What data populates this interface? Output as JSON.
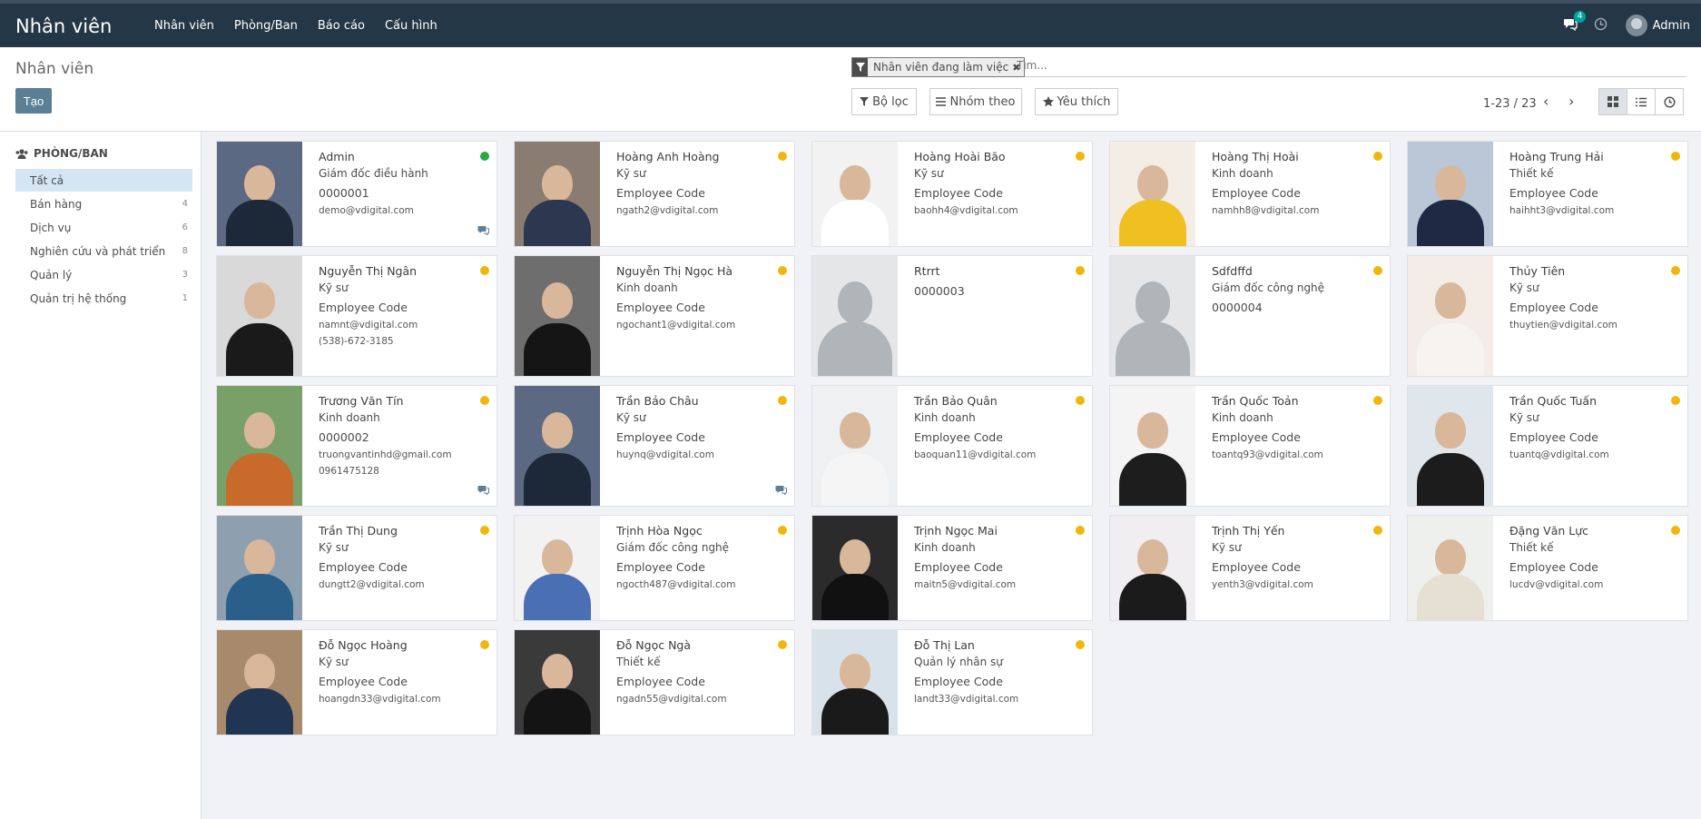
{
  "app": {
    "title": "Nhân viên"
  },
  "menu": [
    "Nhân viên",
    "Phòng/Ban",
    "Báo cáo",
    "Cấu hình"
  ],
  "systray": {
    "messages_count": "4",
    "user": "Admin"
  },
  "control": {
    "breadcrumb": "Nhân viên",
    "create_label": "Tạo",
    "facet": "Nhân viên đang làm việc",
    "search_placeholder": "Tìm...",
    "filter_label": "Bộ lọc",
    "group_label": "Nhóm theo",
    "fav_label": "Yêu thích",
    "pager": "1-23 / 23"
  },
  "sidebar": {
    "title": "PHÒNG/BAN",
    "items": [
      {
        "label": "Tất cả",
        "count": ""
      },
      {
        "label": "Bán hàng",
        "count": "4"
      },
      {
        "label": "Dịch vụ",
        "count": "6"
      },
      {
        "label": "Nghiên cứu và phát triển",
        "count": "8"
      },
      {
        "label": "Quản lý",
        "count": "3"
      },
      {
        "label": "Quản trị hệ thống",
        "count": "1"
      }
    ]
  },
  "employees": [
    {
      "name": "Admin",
      "job": "Giám đốc điều hành",
      "code": "0000001",
      "email": "demo@vdigital.com",
      "phone": "",
      "status": "green",
      "chat": true,
      "bg": "#5b6a82",
      "suit": "#1d2838"
    },
    {
      "name": "Hoàng Anh Hoàng",
      "job": "Kỹ sư",
      "code": "Employee Code",
      "email": "ngath2@vdigital.com",
      "phone": "",
      "status": "yellow",
      "chat": false,
      "bg": "#8a7c70",
      "suit": "#2b3850"
    },
    {
      "name": "Hoàng Hoài Bão",
      "job": "Kỹ sư",
      "code": "Employee Code",
      "email": "baohh4@vdigital.com",
      "phone": "",
      "status": "yellow",
      "chat": false,
      "bg": "#f2f2f2",
      "suit": "#ffffff"
    },
    {
      "name": "Hoàng Thị Hoài",
      "job": "Kinh doanh",
      "code": "Employee Code",
      "email": "namhh8@vdigital.com",
      "phone": "",
      "status": "yellow",
      "chat": false,
      "bg": "#f3ede6",
      "suit": "#f0c020"
    },
    {
      "name": "Hoàng Trung Hải",
      "job": "Thiết kế",
      "code": "Employee Code",
      "email": "haihht3@vdigital.com",
      "phone": "",
      "status": "yellow",
      "chat": false,
      "bg": "#b9c7d6",
      "suit": "#1e2a44"
    },
    {
      "name": "Nguyễn Thị Ngân",
      "job": "Kỹ sư",
      "code": "Employee Code",
      "email": "namnt@vdigital.com",
      "phone": "(538)-672-3185",
      "status": "yellow",
      "chat": false,
      "bg": "#d9d9d9",
      "suit": "#1a1a1a"
    },
    {
      "name": "Nguyễn Thị Ngọc Hà",
      "job": "Kinh doanh",
      "code": "Employee Code",
      "email": "ngochant1@vdigital.com",
      "phone": "",
      "status": "yellow",
      "chat": false,
      "bg": "#6e6e6e",
      "suit": "#151515"
    },
    {
      "name": "Rtrrt",
      "job": "",
      "code": "0000003",
      "email": "",
      "phone": "",
      "status": "yellow",
      "chat": false,
      "bg": "",
      "suit": "",
      "placeholder": true
    },
    {
      "name": "Sdfdffd",
      "job": "Giám đốc công nghệ",
      "code": "0000004",
      "email": "",
      "phone": "",
      "status": "yellow",
      "chat": false,
      "bg": "",
      "suit": "",
      "placeholder": true
    },
    {
      "name": "Thủy Tiên",
      "job": "Kỹ sư",
      "code": "Employee Code",
      "email": "thuytien@vdigital.com",
      "phone": "",
      "status": "yellow",
      "chat": false,
      "bg": "#f4ece6",
      "suit": "#f7f3ef"
    },
    {
      "name": "Trương Văn Tín",
      "job": "Kinh doanh",
      "code": "0000002",
      "email": "truongvantinhd@gmail.com",
      "phone": "0961475128",
      "status": "yellow",
      "chat": true,
      "bg": "#7aa06a",
      "suit": "#c86a2a"
    },
    {
      "name": "Trần Bảo Châu",
      "job": "Kỹ sư",
      "code": "Employee Code",
      "email": "huynq@vdigital.com",
      "phone": "",
      "status": "yellow",
      "chat": true,
      "bg": "#5b6a82",
      "suit": "#1d2838"
    },
    {
      "name": "Trần Bảo Quân",
      "job": "Kinh doanh",
      "code": "Employee Code",
      "email": "baoquan11@vdigital.com",
      "phone": "",
      "status": "yellow",
      "chat": false,
      "bg": "#eef0f2",
      "suit": "#f5f5f5"
    },
    {
      "name": "Trần Quốc Toản",
      "job": "Kinh doanh",
      "code": "Employee Code",
      "email": "toantq93@vdigital.com",
      "phone": "",
      "status": "yellow",
      "chat": false,
      "bg": "#f4f4f4",
      "suit": "#1d1d1d"
    },
    {
      "name": "Trần Quốc Tuấn",
      "job": "Kỹ sư",
      "code": "Employee Code",
      "email": "tuantq@vdigital.com",
      "phone": "",
      "status": "yellow",
      "chat": false,
      "bg": "#dfe6ec",
      "suit": "#1c1c1c"
    },
    {
      "name": "Trần Thị Dung",
      "job": "Kỹ sư",
      "code": "Employee Code",
      "email": "dungtt2@vdigital.com",
      "phone": "",
      "status": "yellow",
      "chat": false,
      "bg": "#8ea0b0",
      "suit": "#2a5f8a"
    },
    {
      "name": "Trịnh Hòa Ngọc",
      "job": "Giám đốc công nghệ",
      "code": "Employee Code",
      "email": "ngocth487@vdigital.com",
      "phone": "",
      "status": "yellow",
      "chat": false,
      "bg": "#f2f2f2",
      "suit": "#4a6fb5"
    },
    {
      "name": "Trịnh Ngọc Mai",
      "job": "Kinh doanh",
      "code": "Employee Code",
      "email": "maitn5@vdigital.com",
      "phone": "",
      "status": "yellow",
      "chat": false,
      "bg": "#2b2b2b",
      "suit": "#111111"
    },
    {
      "name": "Trịnh Thị Yến",
      "job": "Kỹ sư",
      "code": "Employee Code",
      "email": "yenth3@vdigital.com",
      "phone": "",
      "status": "yellow",
      "chat": false,
      "bg": "#f0eef0",
      "suit": "#1b1b1b"
    },
    {
      "name": "Đặng Văn Lực",
      "job": "Thiết kế",
      "code": "Employee Code",
      "email": "lucdv@vdigital.com",
      "phone": "",
      "status": "yellow",
      "chat": false,
      "bg": "#eef0ee",
      "suit": "#e6e0d2"
    },
    {
      "name": "Đỗ Ngọc Hoàng",
      "job": "Kỹ sư",
      "code": "Employee Code",
      "email": "hoangdn33@vdigital.com",
      "phone": "",
      "status": "yellow",
      "chat": false,
      "bg": "#a78a6c",
      "suit": "#1f3552"
    },
    {
      "name": "Đỗ Ngọc Ngà",
      "job": "Thiết kế",
      "code": "Employee Code",
      "email": "ngadn55@vdigital.com",
      "phone": "",
      "status": "yellow",
      "chat": false,
      "bg": "#3a3a3a",
      "suit": "#141414"
    },
    {
      "name": "Đỗ Thị Lan",
      "job": "Quản lý nhân sự",
      "code": "Employee Code",
      "email": "landt33@vdigital.com",
      "phone": "",
      "status": "yellow",
      "chat": false,
      "bg": "#d8e2ea",
      "suit": "#1a1a1a"
    }
  ]
}
